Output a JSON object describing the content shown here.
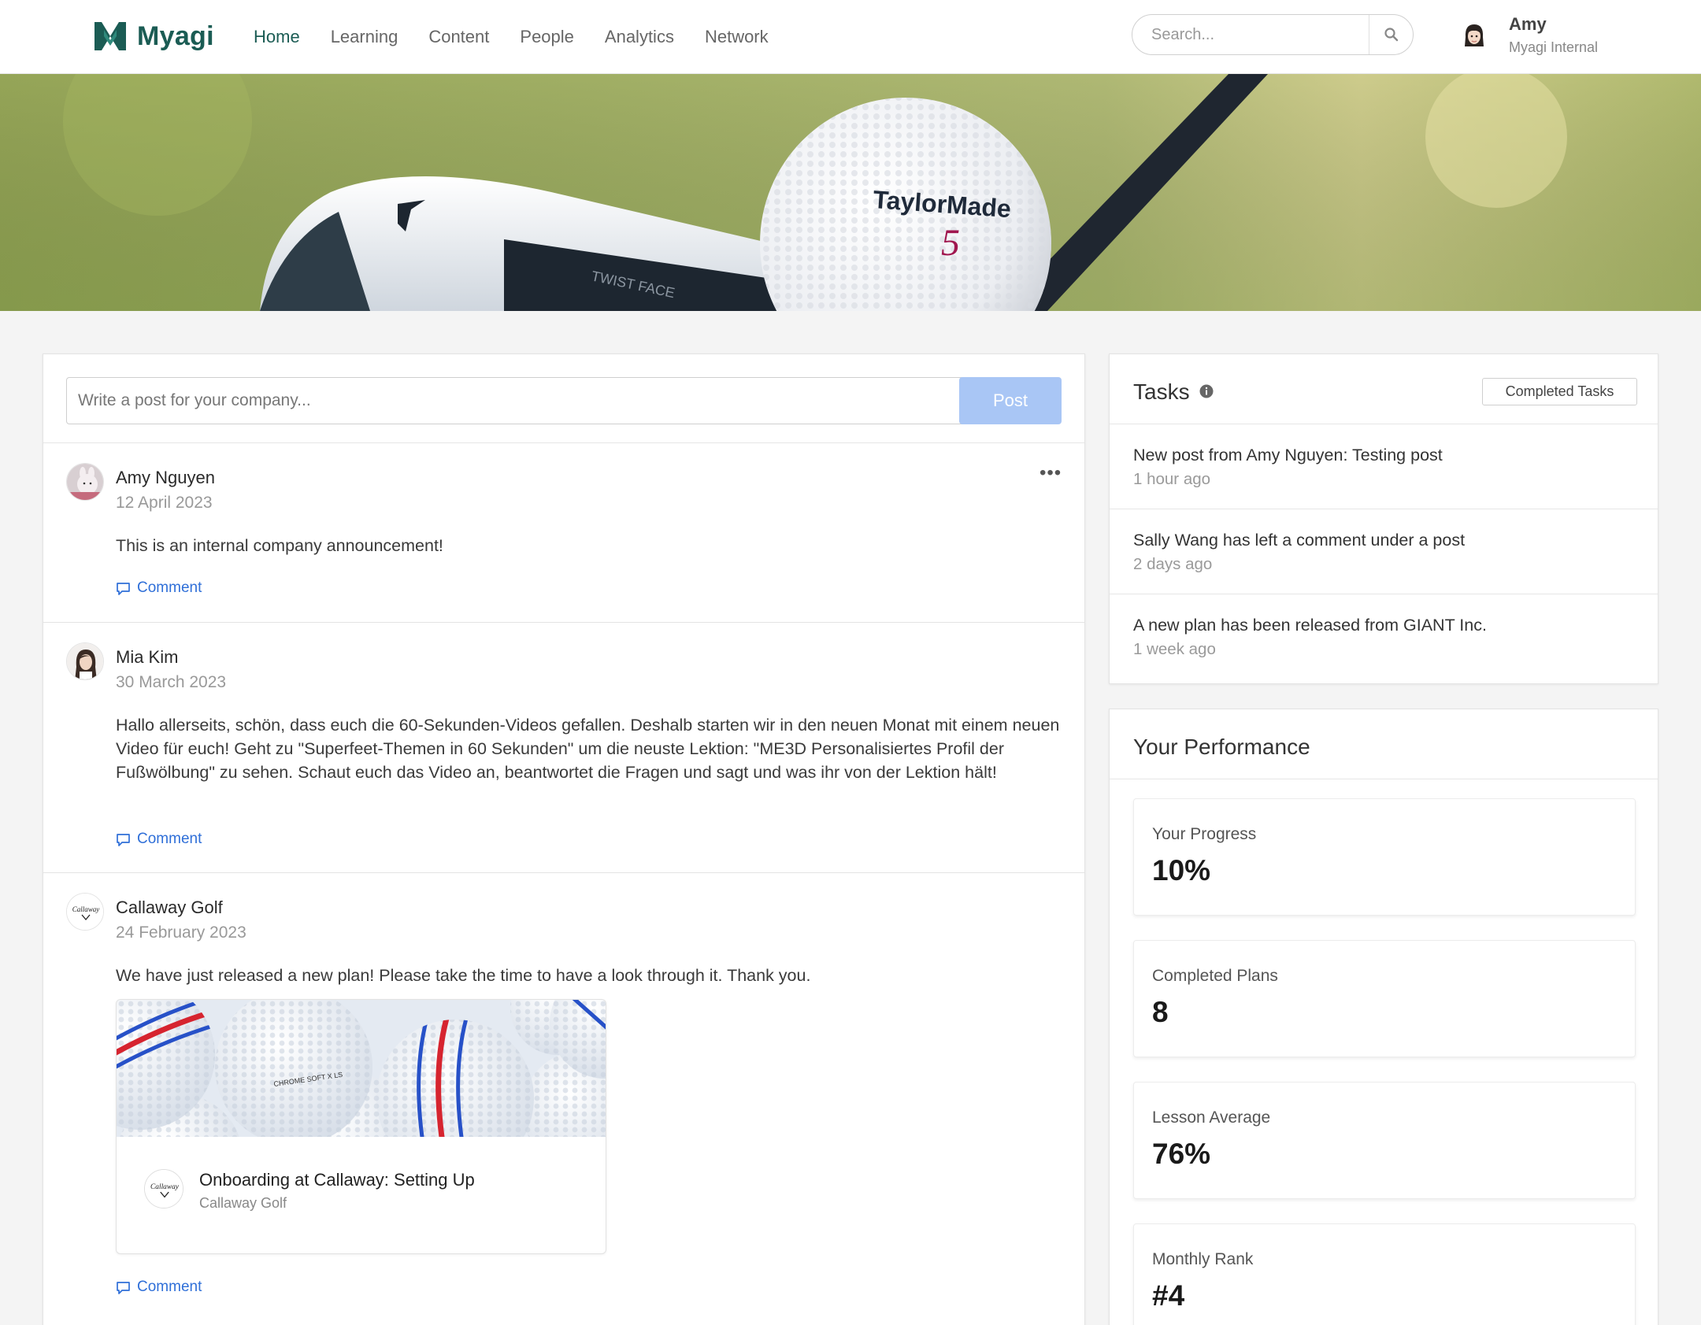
{
  "header": {
    "logo_text": "Myagi",
    "brand_color": "#1b5c54",
    "nav": [
      {
        "label": "Home",
        "active": true
      },
      {
        "label": "Learning",
        "active": false
      },
      {
        "label": "Content",
        "active": false
      },
      {
        "label": "People",
        "active": false
      },
      {
        "label": "Analytics",
        "active": false
      },
      {
        "label": "Network",
        "active": false
      }
    ],
    "search": {
      "placeholder": "Search...",
      "icon": "search-icon"
    },
    "user": {
      "name": "Amy",
      "org": "Myagi Internal"
    }
  },
  "banner": {
    "ball_brand": "TaylorMade",
    "ball_number": "5",
    "club_text": "TWIST FACE"
  },
  "composer": {
    "placeholder": "Write a post for your company...",
    "post_label": "Post"
  },
  "posts": [
    {
      "author": "Amy Nguyen",
      "date": "12 April 2023",
      "body": "This is an internal company announcement!",
      "comment_label": "Comment",
      "menu": "•••"
    },
    {
      "author": "Mia Kim",
      "date": "30 March 2023",
      "body": "Hallo allerseits, schön, dass euch die 60-Sekunden-Videos gefallen. Deshalb starten wir in den neuen Monat mit einem neuen Video für euch! Geht zu \"Superfeet-Themen in 60 Sekunden\" um die neuste Lektion: \"ME3D Personalisiertes Profil der Fußwölbung\" zu sehen. Schaut euch das Video an, beantwortet die Fragen und sagt und was ihr von der Lektion hält!",
      "comment_label": "Comment"
    },
    {
      "author": "Callaway Golf",
      "date": "24 February 2023",
      "body": "We have just released a new plan! Please take the time to have a look through it. Thank you.",
      "plan": {
        "title": "Onboarding at Callaway: Setting Up",
        "company": "Callaway Golf",
        "ball_text": "CHROME SOFT X LS"
      },
      "comment_label": "Comment"
    }
  ],
  "tasks": {
    "title": "Tasks",
    "completed_label": "Completed Tasks",
    "items": [
      {
        "text": "New post from Amy Nguyen: Testing post",
        "time": "1 hour ago"
      },
      {
        "text": "Sally Wang has left a comment under a post",
        "time": "2 days ago"
      },
      {
        "text": "A new plan has been released from GIANT Inc.",
        "time": "1 week ago"
      }
    ]
  },
  "performance": {
    "title": "Your Performance",
    "stats": [
      {
        "label": "Your Progress",
        "value": "10%"
      },
      {
        "label": "Completed Plans",
        "value": "8"
      },
      {
        "label": "Lesson Average",
        "value": "76%"
      },
      {
        "label": "Monthly Rank",
        "value": "#4"
      }
    ]
  }
}
